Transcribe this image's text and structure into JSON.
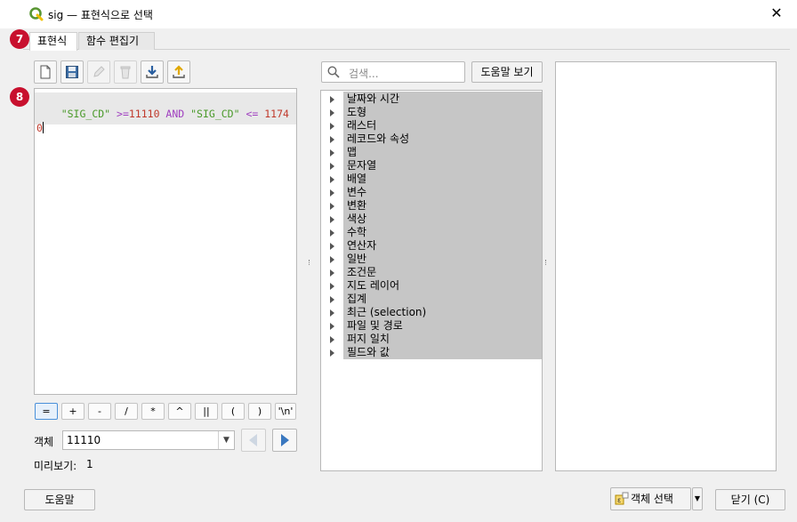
{
  "window": {
    "title": "sig — 표현식으로 선택",
    "close_glyph": "✕"
  },
  "tabs": [
    {
      "label": "표현식"
    },
    {
      "label": "함수 편집기"
    }
  ],
  "badges": {
    "tab_badge": "7",
    "editor_badge": "8"
  },
  "editor": {
    "tokens": [
      {
        "text": "\"SIG_CD\"",
        "kind": "string"
      },
      {
        "text": " >=",
        "kind": "operator"
      },
      {
        "text": "11110",
        "kind": "number"
      },
      {
        "text": " AND ",
        "kind": "operator"
      },
      {
        "text": "\"SIG_CD\"",
        "kind": "string"
      },
      {
        "text": " <= ",
        "kind": "operator"
      },
      {
        "text": "11740",
        "kind": "number"
      }
    ]
  },
  "toolbar": {
    "icons": [
      "new-file-icon",
      "save-icon",
      "edit-icon",
      "delete-icon",
      "import-icon",
      "export-icon"
    ]
  },
  "operators": [
    "=",
    "+",
    "-",
    "/",
    "*",
    "^",
    "||",
    "(",
    ")",
    "'\\n'"
  ],
  "feature": {
    "label": "객체",
    "value": "11110"
  },
  "preview": {
    "label": "미리보기:",
    "value": "1"
  },
  "search": {
    "placeholder": "검색..."
  },
  "help_view_button": "도움말 보기",
  "tree": {
    "items": [
      "날짜와 시간",
      "도형",
      "래스터",
      "레코드와 속성",
      "맵",
      "문자열",
      "배열",
      "변수",
      "변환",
      "색상",
      "수학",
      "연산자",
      "일반",
      "조건문",
      "지도 레이어",
      "집계",
      "최근 (selection)",
      "파일 및 경로",
      "퍼지 일치",
      "필드와 값"
    ]
  },
  "bottom": {
    "help_button": "도움말",
    "select_features_button": "객체 선택",
    "close_button": "닫기 (C)"
  },
  "colors": {
    "string": "#4a9a2a",
    "operator": "#a040c0",
    "number": "#c0392b",
    "badge": "#c8102e"
  }
}
